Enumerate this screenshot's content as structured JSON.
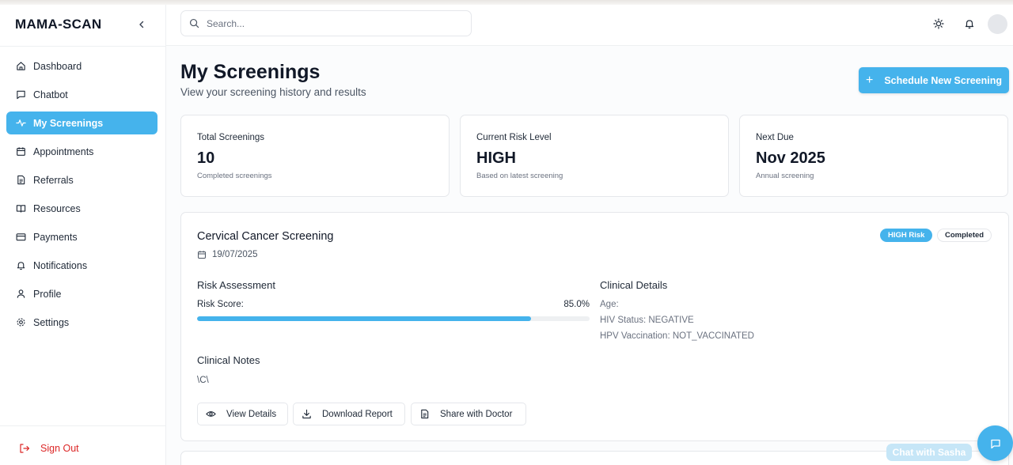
{
  "app": {
    "brand": "MAMA-SCAN"
  },
  "sidebar": {
    "items": [
      {
        "label": "Dashboard",
        "icon": "home-icon"
      },
      {
        "label": "Chatbot",
        "icon": "chat-icon"
      },
      {
        "label": "My Screenings",
        "icon": "activity-icon",
        "active": true
      },
      {
        "label": "Appointments",
        "icon": "calendar-icon"
      },
      {
        "label": "Referrals",
        "icon": "document-icon"
      },
      {
        "label": "Resources",
        "icon": "book-icon"
      },
      {
        "label": "Payments",
        "icon": "credit-card-icon"
      },
      {
        "label": "Notifications",
        "icon": "bell-icon"
      },
      {
        "label": "Profile",
        "icon": "user-icon"
      },
      {
        "label": "Settings",
        "icon": "gear-icon"
      }
    ],
    "sign_out": "Sign Out"
  },
  "header": {
    "search_placeholder": "Search..."
  },
  "page": {
    "title": "My Screenings",
    "subtitle": "View your screening history and results",
    "schedule_button": "Schedule New Screening"
  },
  "stats": [
    {
      "label": "Total Screenings",
      "value": "10",
      "sub": "Completed screenings"
    },
    {
      "label": "Current Risk Level",
      "value": "HIGH",
      "sub": "Based on latest screening"
    },
    {
      "label": "Next Due",
      "value": "Nov 2025",
      "sub": "Annual screening"
    }
  ],
  "screening": {
    "title": "Cervical Cancer Screening",
    "date": "19/07/2025",
    "risk_badge": "HIGH Risk",
    "status_badge": "Completed",
    "risk_heading": "Risk Assessment",
    "risk_score_label": "Risk Score:",
    "risk_score_text": "85.0%",
    "risk_score": 85.0,
    "clinical_heading": "Clinical Details",
    "clinical": [
      "Age:",
      "HIV Status: NEGATIVE",
      "HPV Vaccination: NOT_VACCINATED"
    ],
    "notes_heading": "Clinical Notes",
    "notes": "\\C\\",
    "actions": [
      "View Details",
      "Download Report",
      "Share with Doctor"
    ]
  },
  "chat": {
    "label": "Chat with Sasha"
  },
  "colors": {
    "accent": "#45b3ec",
    "danger": "#dc2626"
  }
}
